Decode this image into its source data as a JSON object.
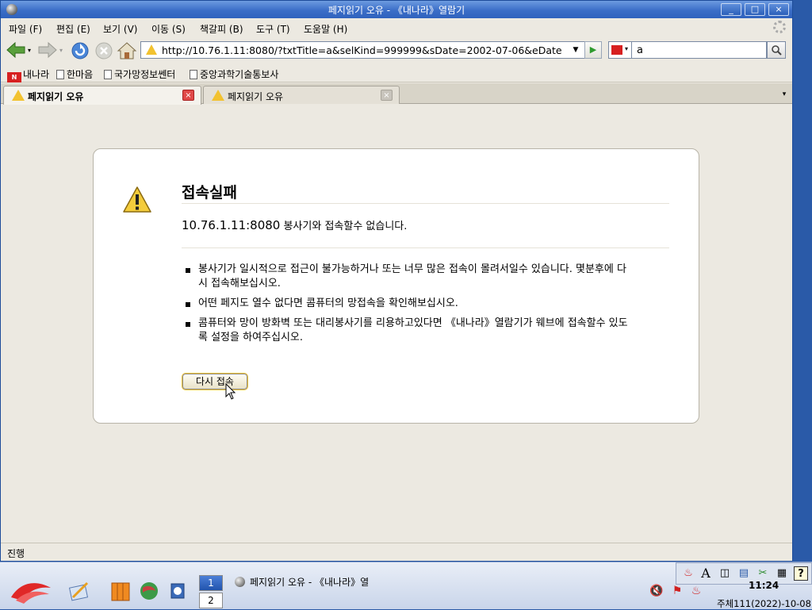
{
  "window": {
    "title": "페지읽기 오유 - 《내나라》열람기",
    "controls": [
      "_",
      "□",
      "×"
    ]
  },
  "menu": [
    "파일 (F)",
    "편집 (E)",
    "보기 (V)",
    "이동 (S)",
    "책갈피 (B)",
    "도구 (T)",
    "도움말 (H)"
  ],
  "nav": {
    "url": "http://10.76.1.11:8080/?txtTitle=a&selKind=999999&sDate=2002-07-06&eDate",
    "search_value": "a",
    "icons": [
      "back-icon",
      "forward-icon",
      "reload-icon",
      "stop-icon",
      "home-icon",
      "search-icon"
    ]
  },
  "bookmarks": [
    "내나라",
    "한마음",
    "국가망정보쎈터",
    "중앙과학기술통보사"
  ],
  "tabs": [
    {
      "label": "페지읽기 오유",
      "active": true
    },
    {
      "label": "페지읽기 오유",
      "active": false
    }
  ],
  "error": {
    "title": "접속실패",
    "host": "10.76.1.11:8080",
    "message_suffix": " 봉사기와 접속할수 없습니다.",
    "items": [
      "봉사기가 일시적으로 접근이 불가능하거나 또는 너무 많은 접속이 몰려서일수 있습니다. 몇분후에 다시 접속해보십시오.",
      "어떤 페지도 열수 없다면 콤퓨터의 망접속을 확인해보십시오.",
      "콤퓨터와 망이 방화벽 또는 대리봉사기를 리용하고있다면 《내나라》열람기가 웨브에 접속할수 있도록 설정을 하여주십시오."
    ],
    "retry_label": "다시 접속"
  },
  "status": "진행",
  "taskbar": {
    "workspaces": [
      "1",
      "2"
    ],
    "task_title": "페지읽기 오유 - 《내나라》열",
    "time": "11:24",
    "date": "주체111(2022)-10-08"
  },
  "colors": {
    "accent": "#2f62bd",
    "warning": "#f2c230",
    "brand_red": "#d72020"
  }
}
